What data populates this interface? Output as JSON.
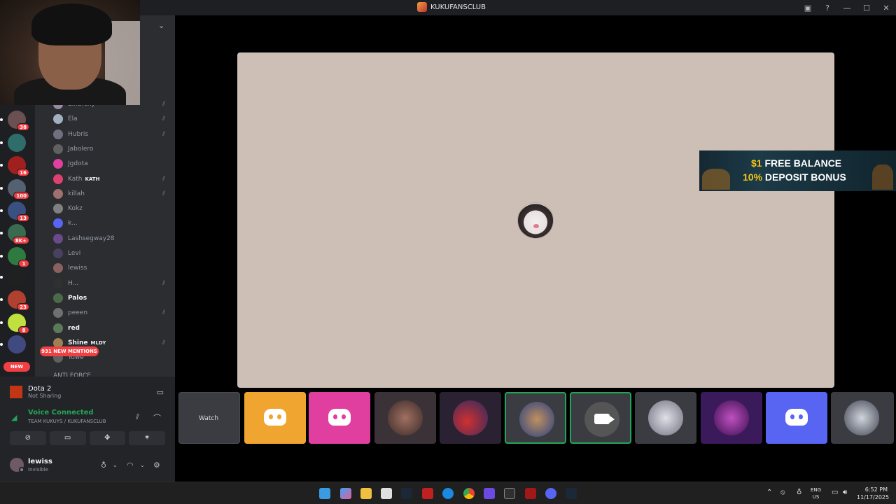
{
  "window": {
    "title": "KUKUFANSCLUB"
  },
  "titlebar_icons": [
    "inbox-icon",
    "help-icon",
    "minimize-icon",
    "maximize-icon",
    "close-icon"
  ],
  "servers": [
    {
      "badge": "38"
    },
    {
      "badge": ""
    },
    {
      "badge": "16"
    },
    {
      "badge": "100"
    },
    {
      "badge": "13"
    },
    {
      "badge": "8K+"
    },
    {
      "badge": "1"
    },
    {
      "badge": ""
    },
    {
      "badge": "23"
    },
    {
      "badge": "8"
    },
    {
      "badge": ""
    }
  ],
  "new_pill": "NEW",
  "members": [
    {
      "name": "Elnarchy",
      "muted": true
    },
    {
      "name": "Ela",
      "muted": true
    },
    {
      "name": "Hubris",
      "muted": true
    },
    {
      "name": "Jabolero",
      "muted": false
    },
    {
      "name": "Jgdota",
      "muted": false
    },
    {
      "name": "Kath",
      "tag": "KATH",
      "muted": true
    },
    {
      "name": "killah",
      "muted": true
    },
    {
      "name": "Kokz",
      "muted": false
    },
    {
      "name": "k...",
      "muted": false
    },
    {
      "name": "Lashsegway28",
      "muted": false
    },
    {
      "name": "Levi",
      "muted": false
    },
    {
      "name": "lewiss",
      "muted": false
    },
    {
      "name": "H...",
      "muted": true
    },
    {
      "name": "Palos",
      "muted": false,
      "bold": true
    },
    {
      "name": "peeen",
      "muted": true
    },
    {
      "name": "red",
      "muted": false,
      "bold": true
    },
    {
      "name": "Shine",
      "tag": "MLDY",
      "muted": true,
      "bold": true
    },
    {
      "name": "Yowe",
      "muted": false
    }
  ],
  "mentions_pill": "931 NEW MENTIONS",
  "cut_row": "ANTI FORCE",
  "activity": {
    "game": "Dota 2",
    "status": "Not Sharing"
  },
  "voice": {
    "status": "Voice Connected",
    "channel": "TEAM KUKUYS / KUKUFANSCLUB"
  },
  "user": {
    "name": "lewiss",
    "status": "Invisible"
  },
  "strip": {
    "watch_label": "Watch"
  },
  "ad": {
    "line1_accent": "$1",
    "line1_rest": " FREE BALANCE",
    "line2_accent": "10%",
    "line2_rest": " DEPOSIT BONUS"
  },
  "taskbar": {
    "lang_top": "ENG",
    "lang_bottom": "US",
    "time": "6:52 PM",
    "date": "11/17/2025"
  }
}
